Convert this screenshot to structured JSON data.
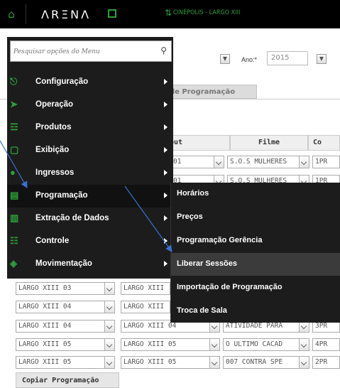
{
  "header": {
    "brand": "ΛRΞNΛ",
    "cinema": "CINÉPOLIS - LARGO XIII"
  },
  "filters": {
    "ano_label": "Ano:*",
    "ano_value": "2015"
  },
  "tab": {
    "label": "de Programação"
  },
  "table": {
    "headers": [
      "out",
      "Filme",
      "Co"
    ],
    "top_rows": [
      {
        "layout": "01",
        "filme": "S.O.S MULHERES",
        "code": "1PR"
      },
      {
        "layout": "01",
        "filme": "S.O.S MULHERES",
        "code": "1PR"
      }
    ],
    "rows": [
      {
        "sala": "LARGO XIII 03",
        "layout": "LARGO XIII",
        "filme": "",
        "code": ""
      },
      {
        "sala": "LARGO XIII 04",
        "layout": "LARGO XIII",
        "filme": "",
        "code": ""
      },
      {
        "sala": "LARGO XIII 04",
        "layout": "LARGO XIII 04",
        "filme": "ATIVIDADE PARA",
        "code": "3PR"
      },
      {
        "sala": "LARGO XIII 05",
        "layout": "LARGO XIII 05",
        "filme": "O ULTIMO CACAD",
        "code": "4PR"
      },
      {
        "sala": "LARGO XIII 05",
        "layout": "LARGO XIII 05",
        "filme": "007 CONTRA SPE",
        "code": "2PR"
      }
    ]
  },
  "copy_button": "Copiar Programação",
  "menu": {
    "search_placeholder": "Pesquisar opções do Menu",
    "items": [
      {
        "label": "Configuração",
        "icon": "network-icon"
      },
      {
        "label": "Operação",
        "icon": "send-icon"
      },
      {
        "label": "Produtos",
        "icon": "cart-icon"
      },
      {
        "label": "Exibição",
        "icon": "screen-icon"
      },
      {
        "label": "Ingressos",
        "icon": "ticket-icon"
      },
      {
        "label": "Programação",
        "icon": "document-icon"
      },
      {
        "label": "Extração de Dados",
        "icon": "chart-icon"
      },
      {
        "label": "Controle",
        "icon": "control-icon"
      },
      {
        "label": "Movimentação",
        "icon": "money-bag-icon"
      }
    ]
  },
  "submenu": {
    "items": [
      {
        "label": "Horários"
      },
      {
        "label": "Preços"
      },
      {
        "label": "Programação Gerência"
      },
      {
        "label": "Liberar Sessões"
      },
      {
        "label": "Importação de Programação"
      },
      {
        "label": "Troca de Sala"
      }
    ]
  },
  "colors": {
    "accent": "#2ea03a",
    "menu_bg": "#1c1c1c",
    "arrow": "#3a6fd1"
  }
}
